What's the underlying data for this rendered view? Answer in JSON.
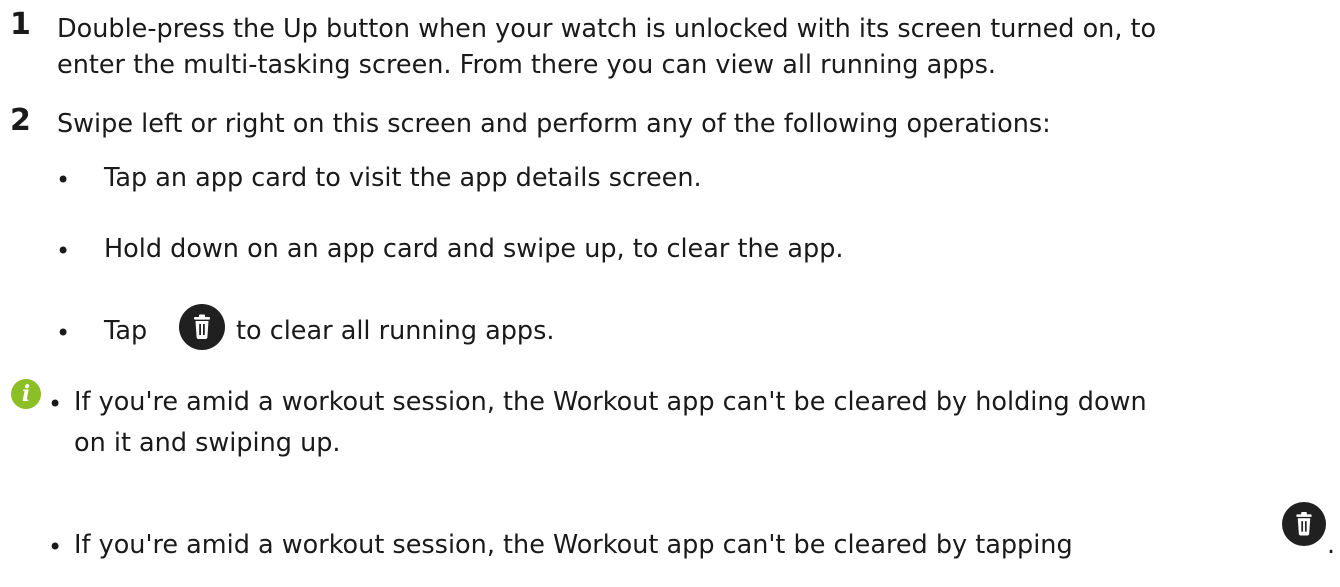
{
  "steps": [
    {
      "number": "1",
      "lines": [
        "Double-press the Up button when your watch is unlocked with its screen turned on, to",
        "enter the multi-tasking screen. From there you can view all running apps."
      ]
    },
    {
      "number": "2",
      "lines": [
        "Swipe left or right on this screen and perform any of the following operations:"
      ],
      "bullets": [
        "Tap an app card to visit the app details screen.",
        "Hold down on an app card and swipe up, to clear the app."
      ],
      "tap_bullet": {
        "before": "Tap",
        "after": "to clear all running apps.",
        "icon": "trash-icon"
      }
    }
  ],
  "bullet_symbol": "•",
  "note": {
    "icon": "info-icon",
    "icon_glyph": "i",
    "icon_color": "#8cbf26",
    "items": [
      {
        "lines": [
          "If you're amid a workout session, the Workout app can't be cleared by holding down",
          "on it and swiping up."
        ]
      },
      {
        "text": "If you're amid a workout session, the Workout app can't be cleared by tapping",
        "trailing": ".",
        "icon": "trash-icon"
      }
    ]
  }
}
